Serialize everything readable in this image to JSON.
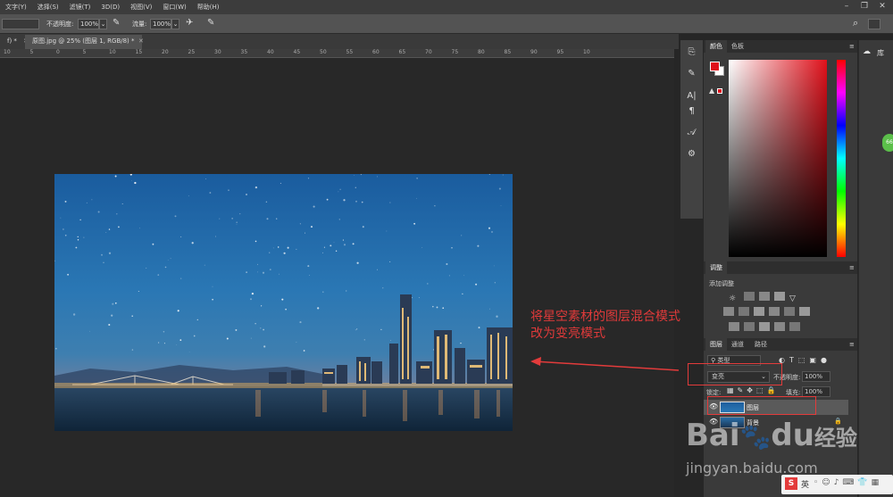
{
  "menu": [
    "文字(Y)",
    "选择(S)",
    "滤镜(T)",
    "3D(D)",
    "视图(V)",
    "窗口(W)",
    "帮助(H)"
  ],
  "options": {
    "opacity_label": "不透明度:",
    "opacity_value": "100%",
    "flow_label": "流量:",
    "flow_value": "100%"
  },
  "tabs": {
    "prev_tab": "f) *",
    "active_tab": "原图.jpg @ 25% (图层 1, RGB/8) *"
  },
  "ruler_ticks": [
    "10",
    "5",
    "0",
    "5",
    "10",
    "15",
    "20",
    "25",
    "30",
    "35",
    "40",
    "45",
    "50",
    "55",
    "60",
    "65",
    "70",
    "75",
    "80",
    "85",
    "90",
    "95",
    "10"
  ],
  "annotation": {
    "line1": "将星空素材的图层混合模式",
    "line2": "改为变亮模式",
    "color": "#e03a3a"
  },
  "color_panel": {
    "tab_color": "颜色",
    "tab_swatches": "色板",
    "foreground": "#e0101a",
    "background": "#ffffff"
  },
  "adjust_panel": {
    "tab": "调整",
    "add_label": "添加调整"
  },
  "layers_panel": {
    "tab_layers": "图层",
    "tab_channels": "通道",
    "tab_paths": "路径",
    "filter_label": "类型",
    "blend_mode": "变亮",
    "opacity_label": "不透明度:",
    "opacity_value": "100%",
    "lock_label": "锁定:",
    "fill_label": "填充:",
    "fill_value": "100%",
    "layer1_name": "图层",
    "layer2_name": "背景"
  },
  "library": {
    "label": "库"
  },
  "watermark": {
    "brand": "Bai",
    "du": "du",
    "cn": "经验",
    "url": "jingyan.baidu.com"
  },
  "taskbar": {
    "ime": "英"
  },
  "badge": "66"
}
